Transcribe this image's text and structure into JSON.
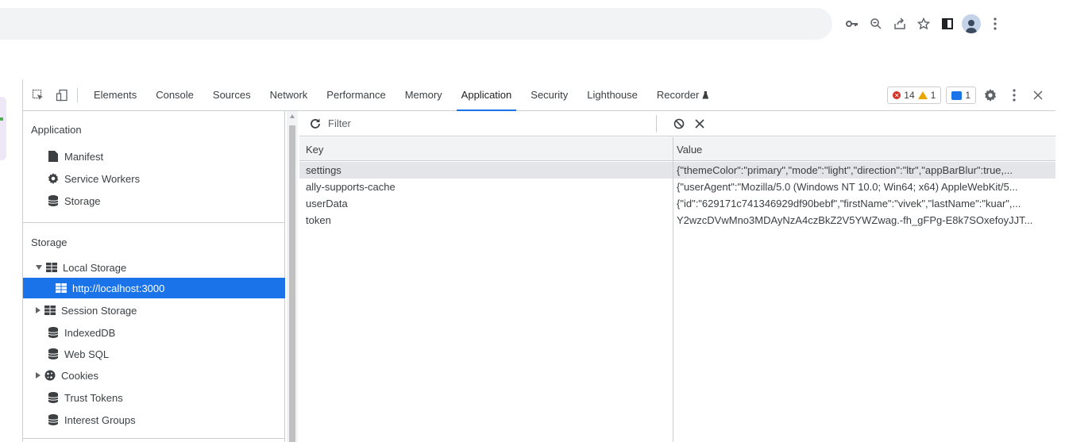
{
  "devtools": {
    "tabs": [
      {
        "label": "Elements"
      },
      {
        "label": "Console"
      },
      {
        "label": "Sources"
      },
      {
        "label": "Network"
      },
      {
        "label": "Performance"
      },
      {
        "label": "Memory"
      },
      {
        "label": "Application"
      },
      {
        "label": "Security"
      },
      {
        "label": "Lighthouse"
      },
      {
        "label": "Recorder"
      }
    ],
    "active_tab": "Application",
    "errors_count": "14",
    "warnings_count": "1",
    "messages_count": "1"
  },
  "sidebar": {
    "application_title": "Application",
    "application_items": [
      {
        "label": "Manifest",
        "icon": "file-icon"
      },
      {
        "label": "Service Workers",
        "icon": "gear-icon"
      },
      {
        "label": "Storage",
        "icon": "database-icon"
      }
    ],
    "storage_title": "Storage",
    "storage_items": [
      {
        "label": "Local Storage",
        "icon": "grid-icon"
      },
      {
        "label": "http://localhost:3000",
        "icon": "grid-icon"
      },
      {
        "label": "Session Storage",
        "icon": "grid-icon"
      },
      {
        "label": "IndexedDB",
        "icon": "database-icon"
      },
      {
        "label": "Web SQL",
        "icon": "database-icon"
      },
      {
        "label": "Cookies",
        "icon": "cookie-icon"
      },
      {
        "label": "Trust Tokens",
        "icon": "database-icon"
      },
      {
        "label": "Interest Groups",
        "icon": "database-icon"
      }
    ]
  },
  "filter": {
    "placeholder": "Filter"
  },
  "table": {
    "headers": {
      "key": "Key",
      "value": "Value"
    },
    "rows": [
      {
        "key": "settings",
        "value": "{\"themeColor\":\"primary\",\"mode\":\"light\",\"direction\":\"ltr\",\"appBarBlur\":true,..."
      },
      {
        "key": "ally-supports-cache",
        "value": "{\"userAgent\":\"Mozilla/5.0 (Windows NT 10.0; Win64; x64) AppleWebKit/5..."
      },
      {
        "key": "userData",
        "value": "{\"id\":\"629171c741346929df90bebf\",\"firstName\":\"vivek\",\"lastName\":\"kuar\",..."
      },
      {
        "key": "token",
        "value": "Y2wzcDVwMno3MDAyNzA4czBkZ2V5YWZwag.-fh_gFPg-E8k7SOxefoyJJT..."
      }
    ]
  }
}
